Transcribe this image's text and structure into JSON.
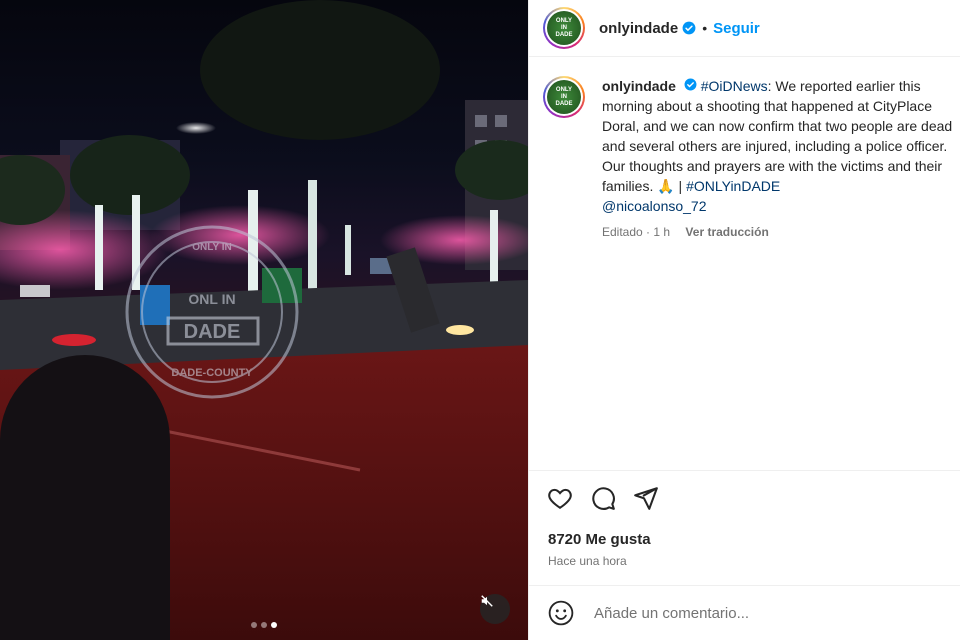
{
  "post": {
    "username": "onlyindade",
    "follow_label": "Seguir",
    "separator": "•",
    "caption": {
      "username": "onlyindade",
      "hashtag": "#OiDNews",
      "text": ": We reported earlier this morning about a shooting that happened at CityPlace Doral, and we can now confirm that two people are dead and several others are injured, including a police officer. Our thoughts and prayers are with the victims and their families. ",
      "emoji": "🙏",
      "divider": " | ",
      "hashtag2": "#ONLYinDADE",
      "mention": "@nicoalonso_72"
    },
    "edited_label": "Editado",
    "meta_sep": "·",
    "edited_time": "1 h",
    "translate_label": "Ver traducción",
    "likes": "8720 Me gusta",
    "timestamp": "Hace una hora",
    "comment_placeholder": "Añade un comentario..."
  },
  "avatar": {
    "line1": "ONLY",
    "line2": "IN",
    "line3": "DADE"
  },
  "media": {
    "watermark_top": "ONLY IN",
    "watermark_main": "DADE",
    "watermark_bottom": "DADE-COUNTY",
    "watermark_side": "ONL IN",
    "carousel": {
      "count": 3,
      "active": 3
    }
  },
  "icons": [
    "heart-icon",
    "comment-icon",
    "share-icon",
    "emoji-icon",
    "mute-icon",
    "verified-icon"
  ],
  "colors": {
    "accent": "#0095f6",
    "link": "#00376b",
    "muted": "#737373",
    "text": "#262626"
  }
}
